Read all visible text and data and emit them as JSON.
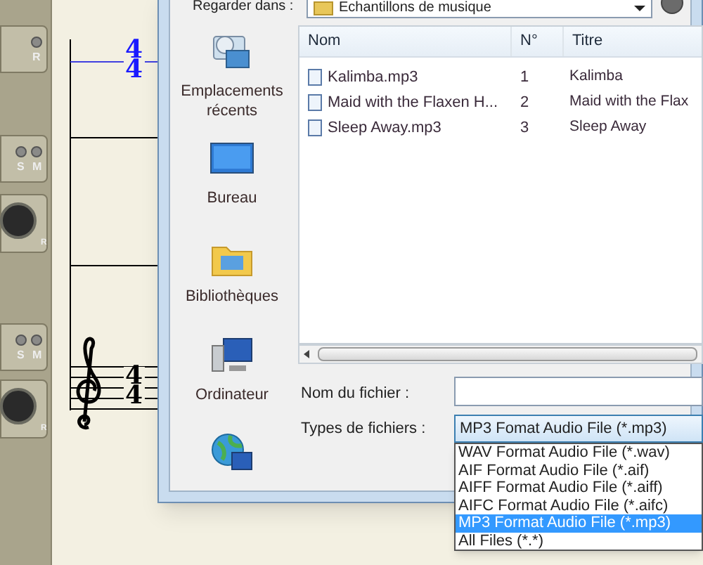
{
  "mixer": [
    {
      "leds": [
        "R"
      ]
    },
    {
      "leds": [
        "S",
        "M"
      ],
      "knob_labels": [
        "R"
      ]
    },
    {
      "leds": [
        "S",
        "M"
      ],
      "knob_labels": [
        "R"
      ]
    }
  ],
  "staves": [
    {
      "time_signature": [
        "4",
        "4"
      ],
      "highlighted": true,
      "treble_clef": false
    },
    {
      "time_signature": [
        "4",
        "4"
      ],
      "highlighted": false,
      "treble_clef": true
    }
  ],
  "dialog": {
    "location": {
      "label": "Regarder dans :",
      "value": "Echantillons de musique"
    },
    "places": [
      {
        "kind": "recent",
        "label": "Emplacements récents"
      },
      {
        "kind": "desktop",
        "label": "Bureau"
      },
      {
        "kind": "libraries",
        "label": "Bibliothèques"
      },
      {
        "kind": "computer",
        "label": "Ordinateur"
      },
      {
        "kind": "network"
      }
    ],
    "file_list": {
      "columns": [
        "Nom",
        "N°",
        "Titre"
      ],
      "rows": [
        {
          "name": "Kalimba.mp3",
          "number": "1",
          "title": "Kalimba"
        },
        {
          "name": "Maid with the Flaxen H...",
          "number": "2",
          "title": "Maid with the Flax"
        },
        {
          "name": "Sleep Away.mp3",
          "number": "3",
          "title": "Sleep Away"
        }
      ]
    },
    "file_name": {
      "label": "Nom du fichier :"
    },
    "file_type": {
      "label": "Types de fichiers :",
      "value": "MP3 Fomat Audio File (*.mp3)",
      "options": [
        {
          "label": "WAV Format Audio File (*.wav)",
          "selected": false
        },
        {
          "label": "AIF Format Audio File (*.aif)",
          "selected": false
        },
        {
          "label": "AIFF Format Audio File (*.aiff)",
          "selected": false
        },
        {
          "label": "AIFC Format Audio File (*.aifc)",
          "selected": false
        },
        {
          "label": "MP3 Format Audio File (*.mp3)",
          "selected": true
        },
        {
          "label": "All Files (*.*)",
          "selected": false
        }
      ]
    }
  }
}
